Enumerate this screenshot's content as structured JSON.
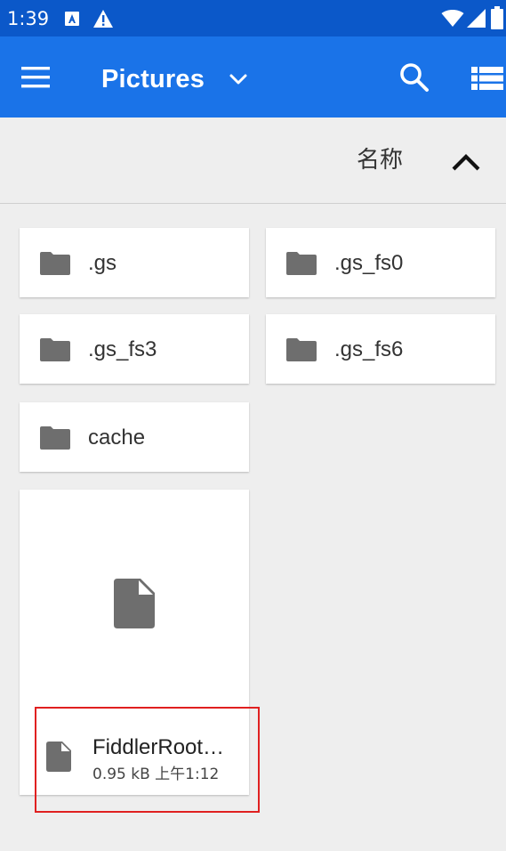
{
  "status_bar": {
    "time": "1:39",
    "icons": [
      "keyboard-a-icon",
      "warning-icon",
      "wifi-icon",
      "signal-icon",
      "battery-icon"
    ]
  },
  "app_bar": {
    "title": "Pictures",
    "icons": [
      "menu-icon",
      "chevron-down-icon",
      "search-icon",
      "list-view-icon"
    ]
  },
  "sort_bar": {
    "label": "名称",
    "direction_icon": "chevron-up-icon"
  },
  "folders": [
    {
      "name": ".gs"
    },
    {
      "name": ".gs_fs0"
    },
    {
      "name": ".gs_fs3"
    },
    {
      "name": ".gs_fs6"
    },
    {
      "name": "cache"
    }
  ],
  "file": {
    "name": "FiddlerRoot…",
    "meta": "0.95 kB 上午1:12"
  },
  "colors": {
    "app_bar": "#1a73e8",
    "status_bar": "#0b58c9",
    "background": "#eeeeee",
    "icon_grey": "#6e6e6e",
    "highlight": "#e02020"
  }
}
